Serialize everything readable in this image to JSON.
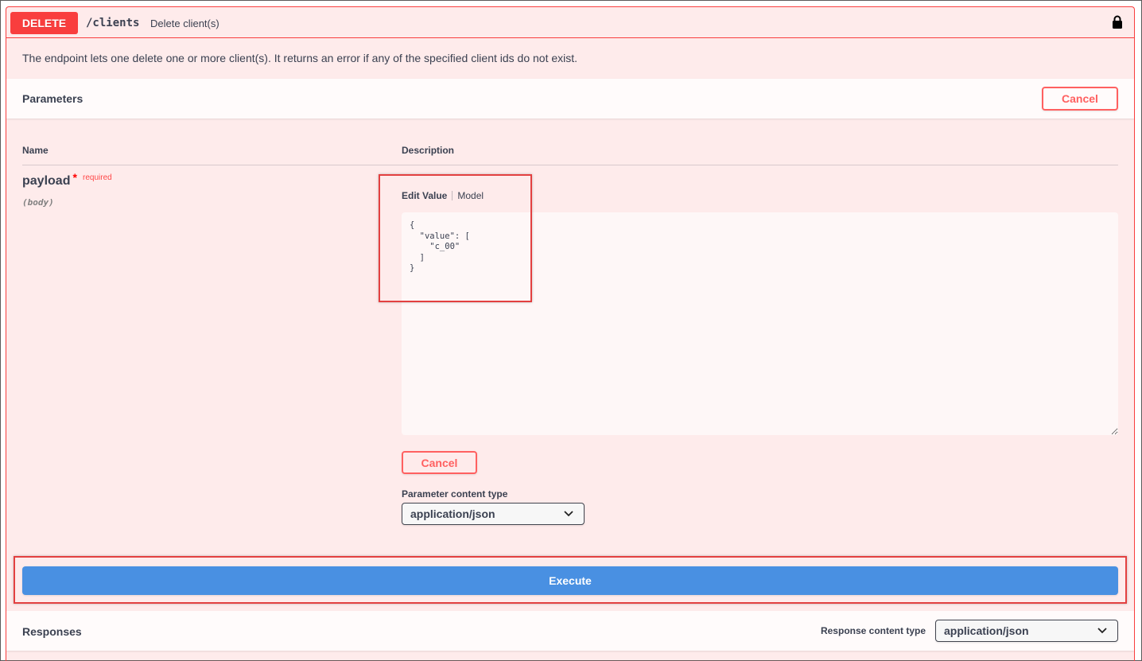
{
  "operation": {
    "method": "DELETE",
    "path": "/clients",
    "summary": "Delete client(s)",
    "description": "The endpoint lets one delete one or more client(s). It returns an error if any of the specified client ids do not exist."
  },
  "parameters": {
    "title": "Parameters",
    "cancel_label": "Cancel",
    "columns": {
      "name": "Name",
      "description": "Description"
    },
    "param": {
      "name": "payload",
      "required_mark": "*",
      "required_label": "required",
      "location": "(body)"
    },
    "tabs": {
      "edit_value": "Edit Value",
      "model": "Model"
    },
    "body_value": "{\n  \"value\": [\n    \"c_00\"\n  ]\n}",
    "inline_cancel_label": "Cancel",
    "content_type_label": "Parameter content type",
    "content_type_value": "application/json"
  },
  "execute_label": "Execute",
  "responses": {
    "title": "Responses",
    "content_type_label": "Response content type",
    "content_type_value": "application/json"
  },
  "colors": {
    "delete": "#f93e3e",
    "execute": "#4990e2",
    "highlight": "#e34040"
  }
}
